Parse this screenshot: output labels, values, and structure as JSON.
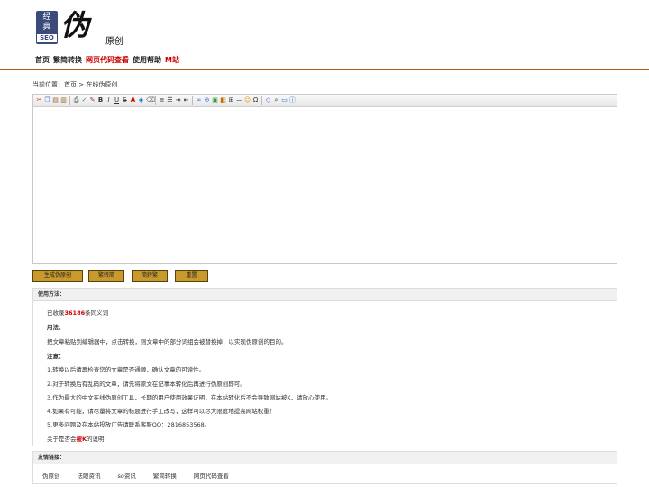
{
  "logo": {
    "seal_line1": "经",
    "seal_line2": "典",
    "seal_badge": "SEO",
    "brush_text": "伪",
    "sub_text": "原创"
  },
  "nav": [
    {
      "label": "首页",
      "highlight": false
    },
    {
      "label": "繁简转换",
      "highlight": false
    },
    {
      "label": "网页代码查看",
      "highlight": true
    },
    {
      "label": "使用帮助",
      "highlight": false
    },
    {
      "label": "M站",
      "highlight": true
    }
  ],
  "breadcrumb": "当前位置：首页 > 在线伪原创",
  "editor": {
    "content": "",
    "toolbar_icons": [
      "cut-icon",
      "copy-icon",
      "paste-icon",
      "paste-text-icon",
      "sep",
      "print-icon",
      "spellcheck-icon",
      "format-painter-icon",
      "bold-icon",
      "italic-icon",
      "underline-icon",
      "strikethrough-icon",
      "font-color-icon",
      "bg-color-icon",
      "clear-format-icon",
      "sep",
      "align-left-icon",
      "list-icon",
      "indent-icon",
      "outdent-icon",
      "sep",
      "link-icon",
      "unlink-icon",
      "image-icon",
      "flash-icon",
      "table-icon",
      "hr-icon",
      "emoticon-icon",
      "special-char-icon",
      "sep",
      "source-icon",
      "preview-icon",
      "fullscreen-icon",
      "about-icon"
    ]
  },
  "buttons": {
    "generate": "生成伪原创",
    "to_simplified": "繁转简",
    "to_traditional": "简转繁",
    "reset": "重置"
  },
  "usage": {
    "title": "使用方法：",
    "count_prefix": "已收录",
    "count": "36186",
    "count_suffix": "条同义词",
    "method_heading": "用法：",
    "method_text": "把文章粘贴到编辑器中，点击转换，则文章中的部分词组会被替换掉，以实现伪原创的目的。",
    "notes_heading": "注意：",
    "notes": [
      "1.转换以后请再检查您的文章是否通顺，确认文章的可读性。",
      "2.对于转换后有乱码的文章，请先将原文在记事本转化后再进行伪原创即可。",
      "3.作为最大的中文在线伪原创工具，长期的用户使用效果证明，在本站转化后不会导致网站被K，请放心使用。",
      "4.如果有可能，请尽量将文章的标题进行手工改写，这样可以尽大限度地提高网站权重！",
      "5.更多问题及在本站投放广告请联系客服QQ：2816853568。"
    ],
    "k_prefix": "关于是否会",
    "k_red": "被K",
    "k_suffix": "的说明"
  },
  "friend_links": {
    "title": "友情链接：",
    "items": [
      "伪原创",
      "法眼资讯",
      "so资讯",
      "繁简转换",
      "网页代码查看"
    ]
  }
}
